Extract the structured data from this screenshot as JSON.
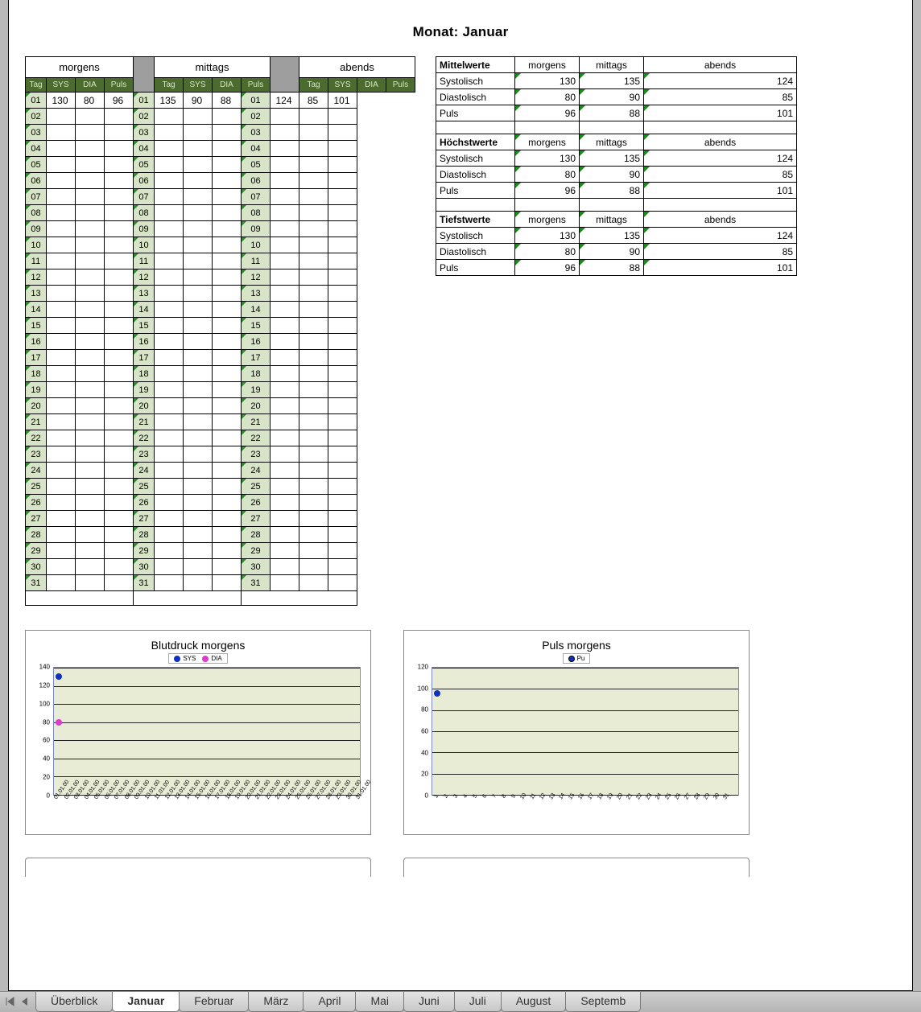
{
  "title": "Monat: Januar",
  "periods": [
    "morgens",
    "mittags",
    "abends"
  ],
  "columns": [
    "Tag",
    "SYS",
    "DIA",
    "Puls"
  ],
  "days": [
    "01",
    "02",
    "03",
    "04",
    "05",
    "06",
    "07",
    "08",
    "09",
    "10",
    "11",
    "12",
    "13",
    "14",
    "15",
    "16",
    "17",
    "18",
    "19",
    "20",
    "21",
    "22",
    "23",
    "24",
    "25",
    "26",
    "27",
    "28",
    "29",
    "30",
    "31"
  ],
  "entries": {
    "morgens": {
      "01": {
        "sys": 130,
        "dia": 80,
        "puls": 96
      }
    },
    "mittags": {
      "01": {
        "sys": 135,
        "dia": 90,
        "puls": 88
      }
    },
    "abends": {
      "01": {
        "sys": 124,
        "dia": 85,
        "puls": 101
      }
    }
  },
  "stats": {
    "groups": [
      "Mittelwerte",
      "Höchstwerte",
      "Tiefstwerte"
    ],
    "rows": [
      "Systolisch",
      "Diastolisch",
      "Puls"
    ],
    "Mittelwerte": {
      "Systolisch": {
        "morgens": 130,
        "mittags": 135,
        "abends": 124
      },
      "Diastolisch": {
        "morgens": 80,
        "mittags": 90,
        "abends": 85
      },
      "Puls": {
        "morgens": 96,
        "mittags": 88,
        "abends": 101
      }
    },
    "Höchstwerte": {
      "Systolisch": {
        "morgens": 130,
        "mittags": 135,
        "abends": 124
      },
      "Diastolisch": {
        "morgens": 80,
        "mittags": 90,
        "abends": 85
      },
      "Puls": {
        "morgens": 96,
        "mittags": 88,
        "abends": 101
      }
    },
    "Tiefstwerte": {
      "Systolisch": {
        "morgens": 130,
        "mittags": 135,
        "abends": 124
      },
      "Diastolisch": {
        "morgens": 80,
        "mittags": 90,
        "abends": 85
      },
      "Puls": {
        "morgens": 96,
        "mittags": 88,
        "abends": 101
      }
    }
  },
  "chart_data": [
    {
      "type": "line",
      "title": "Blutdruck morgens",
      "x": [
        "01.01.00",
        "02.01.00",
        "03.01.00",
        "04.01.00",
        "05.01.00",
        "06.01.00",
        "07.01.00",
        "08.01.00",
        "09.01.00",
        "10.01.00",
        "11.01.00",
        "12.01.00",
        "13.01.00",
        "14.01.00",
        "15.01.00",
        "16.01.00",
        "17.01.00",
        "18.01.00",
        "19.01.00",
        "20.01.00",
        "21.01.00",
        "22.01.00",
        "23.01.00",
        "24.01.00",
        "25.01.00",
        "26.01.00",
        "27.01.00",
        "28.01.00",
        "29.01.00",
        "30.01.00",
        "31.01.00"
      ],
      "series": [
        {
          "name": "SYS",
          "color": "#1030c0",
          "values": [
            130,
            null,
            null,
            null,
            null,
            null,
            null,
            null,
            null,
            null,
            null,
            null,
            null,
            null,
            null,
            null,
            null,
            null,
            null,
            null,
            null,
            null,
            null,
            null,
            null,
            null,
            null,
            null,
            null,
            null,
            null
          ]
        },
        {
          "name": "DIA",
          "color": "#e03bd0",
          "values": [
            80,
            null,
            null,
            null,
            null,
            null,
            null,
            null,
            null,
            null,
            null,
            null,
            null,
            null,
            null,
            null,
            null,
            null,
            null,
            null,
            null,
            null,
            null,
            null,
            null,
            null,
            null,
            null,
            null,
            null,
            null
          ]
        }
      ],
      "ylim": [
        0,
        140
      ],
      "yticks": [
        0,
        20,
        40,
        60,
        80,
        100,
        120,
        140
      ]
    },
    {
      "type": "line",
      "title": "Puls morgens",
      "x": [
        1,
        2,
        3,
        4,
        5,
        6,
        7,
        8,
        9,
        10,
        11,
        12,
        13,
        14,
        15,
        16,
        17,
        18,
        19,
        20,
        21,
        22,
        23,
        24,
        25,
        26,
        27,
        28,
        29,
        30,
        31
      ],
      "series": [
        {
          "name": "Pu",
          "color": "#1030c0",
          "values": [
            96,
            null,
            null,
            null,
            null,
            null,
            null,
            null,
            null,
            null,
            null,
            null,
            null,
            null,
            null,
            null,
            null,
            null,
            null,
            null,
            null,
            null,
            null,
            null,
            null,
            null,
            null,
            null,
            null,
            null,
            null
          ]
        }
      ],
      "ylim": [
        0,
        120
      ],
      "yticks": [
        0,
        20,
        40,
        60,
        80,
        100,
        120
      ]
    }
  ],
  "sheet_tabs": [
    "Überblick",
    "Januar",
    "Februar",
    "März",
    "April",
    "Mai",
    "Juni",
    "Juli",
    "August",
    "Septemb"
  ],
  "active_tab": "Januar"
}
